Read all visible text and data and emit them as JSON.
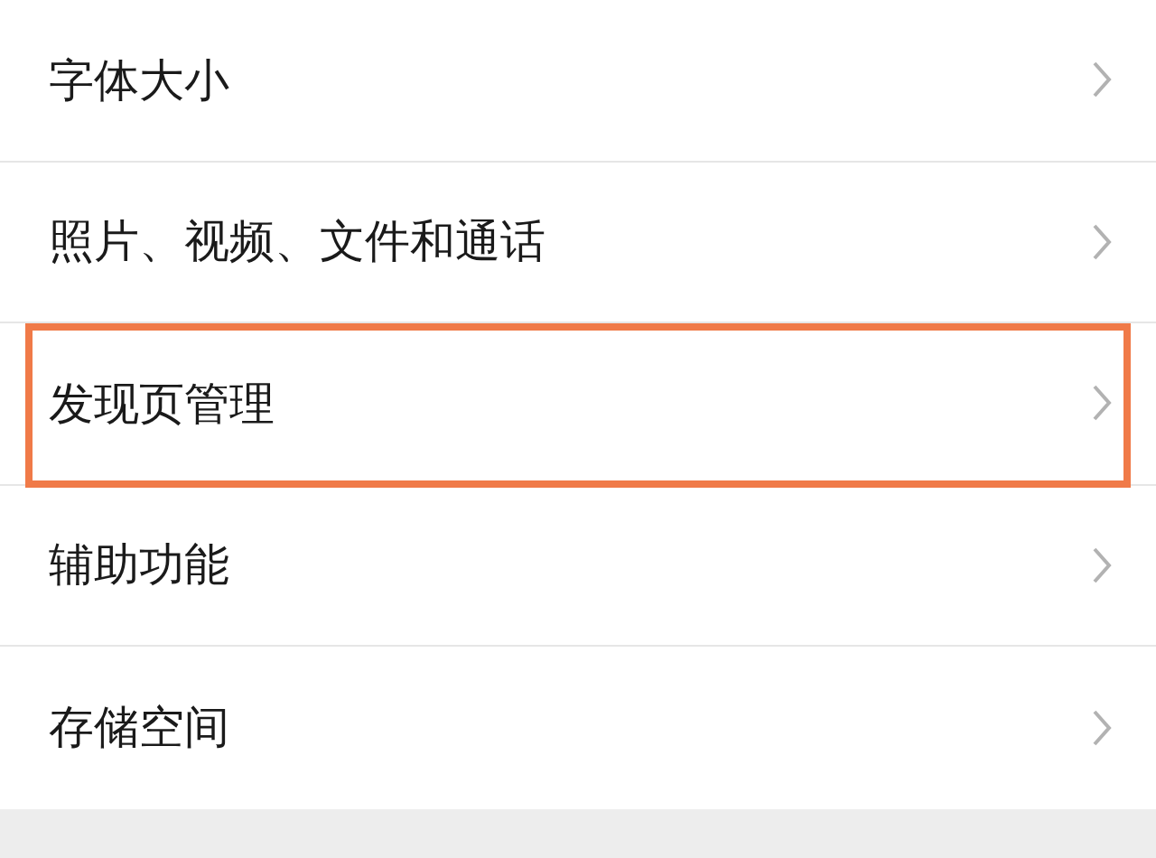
{
  "settings_list": [
    {
      "label": "字体大小",
      "highlighted": false
    },
    {
      "label": "照片、视频、文件和通话",
      "highlighted": false
    },
    {
      "label": "发现页管理",
      "highlighted": true
    },
    {
      "label": "辅助功能",
      "highlighted": false
    },
    {
      "label": "存储空间",
      "highlighted": false
    }
  ]
}
